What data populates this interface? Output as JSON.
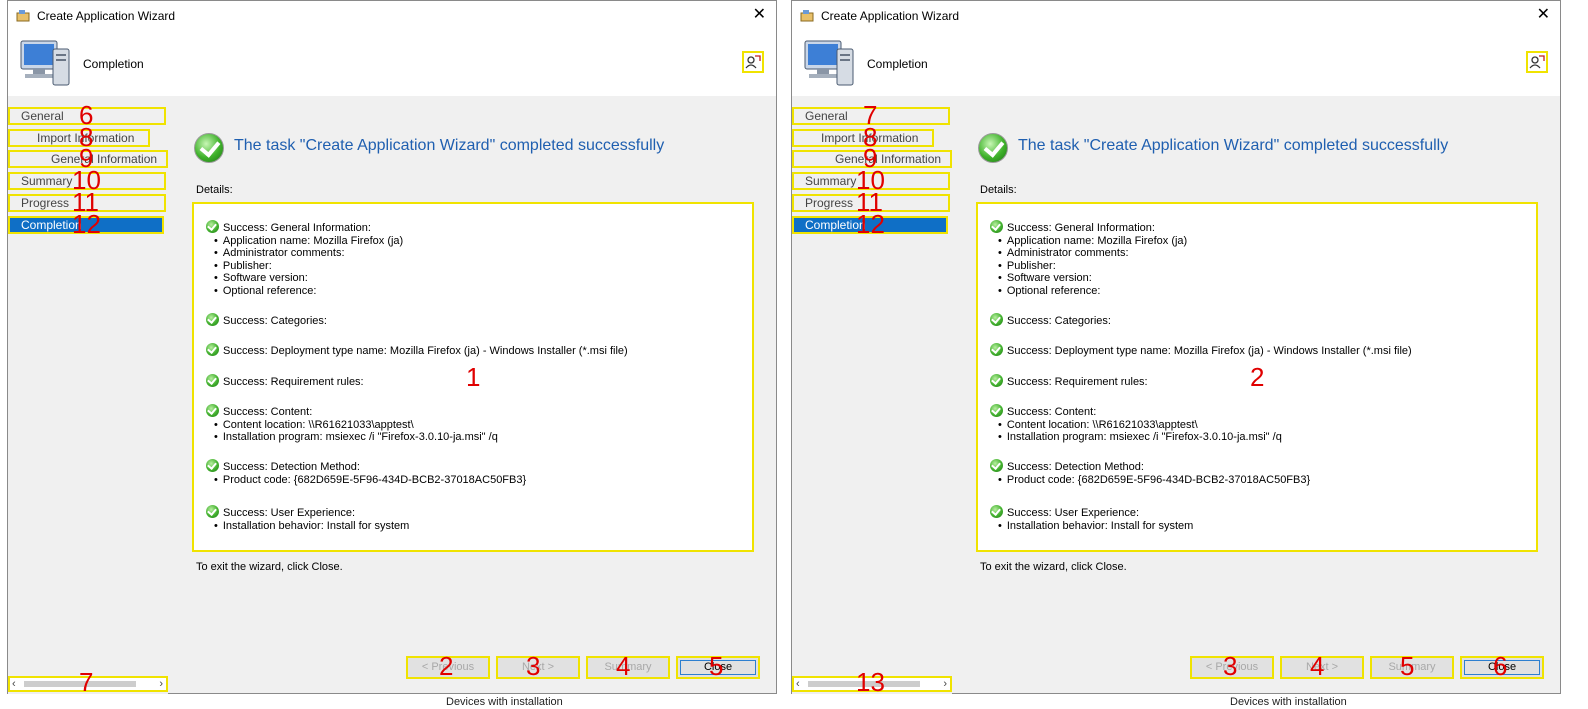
{
  "background": {
    "footer_text": "Devices with installation"
  },
  "windows": [
    {
      "title": "Create Application Wizard",
      "header_title": "Completion",
      "nav": [
        {
          "label": "General",
          "num": "6"
        },
        {
          "label": "Import Information",
          "num": "8"
        },
        {
          "label": "General Information",
          "num": "9"
        },
        {
          "label": "Summary",
          "num": "10"
        },
        {
          "label": "Progress",
          "num": "11"
        },
        {
          "label": "Completion",
          "num": "12"
        }
      ],
      "scroll_num": "7",
      "success_title": "The task \"Create Application Wizard\" completed successfully",
      "details_label": "Details:",
      "details_num": "1",
      "groups": [
        {
          "head": "Success: General Information:",
          "items": [
            "Application name: Mozilla Firefox (ja)",
            "Administrator comments:",
            "Publisher:",
            "Software version:",
            "Optional reference:"
          ]
        },
        {
          "head": "Success: Categories:",
          "items": []
        },
        {
          "head": "Success: Deployment type name: Mozilla Firefox (ja) - Windows Installer (*.msi file)",
          "items": []
        },
        {
          "head": "Success: Requirement rules:",
          "items": []
        },
        {
          "head": "Success: Content:",
          "items": [
            "Content location: \\\\R61621033\\apptest\\",
            "Installation program: msiexec /i \"Firefox-3.0.10-ja.msi\" /q"
          ]
        },
        {
          "head": "Success: Detection Method:",
          "items": [
            "Product code: {682D659E-5F96-434D-BCB2-37018AC50FB3}"
          ]
        },
        {
          "head": "Success: User Experience:",
          "items": [
            "Installation behavior: Install for system"
          ]
        }
      ],
      "exit_text": "To exit the wizard, click Close.",
      "buttons": [
        {
          "label": "< Previous",
          "num": "2",
          "enabled": false
        },
        {
          "label": "Next >",
          "num": "3",
          "enabled": false
        },
        {
          "label": "Summary",
          "num": "4",
          "enabled": false
        },
        {
          "label": "Close",
          "num": "5",
          "enabled": true
        }
      ]
    },
    {
      "title": "Create Application Wizard",
      "header_title": "Completion",
      "nav": [
        {
          "label": "General",
          "num": "7"
        },
        {
          "label": "Import Information",
          "num": "8"
        },
        {
          "label": "General Information",
          "num": "9"
        },
        {
          "label": "Summary",
          "num": "10"
        },
        {
          "label": "Progress",
          "num": "11"
        },
        {
          "label": "Completion",
          "num": "12"
        }
      ],
      "scroll_num": "13",
      "success_title": "The task \"Create Application Wizard\" completed successfully",
      "details_label": "Details:",
      "details_num": "2",
      "groups": [
        {
          "head": "Success: General Information:",
          "items": [
            "Application name: Mozilla Firefox (ja)",
            "Administrator comments:",
            "Publisher:",
            "Software version:",
            "Optional reference:"
          ]
        },
        {
          "head": "Success: Categories:",
          "items": []
        },
        {
          "head": "Success: Deployment type name: Mozilla Firefox (ja) - Windows Installer (*.msi file)",
          "items": []
        },
        {
          "head": "Success: Requirement rules:",
          "items": []
        },
        {
          "head": "Success: Content:",
          "items": [
            "Content location: \\\\R61621033\\apptest\\",
            "Installation program: msiexec /i \"Firefox-3.0.10-ja.msi\" /q"
          ]
        },
        {
          "head": "Success: Detection Method:",
          "items": [
            "Product code: {682D659E-5F96-434D-BCB2-37018AC50FB3}"
          ]
        },
        {
          "head": "Success: User Experience:",
          "items": [
            "Installation behavior: Install for system"
          ]
        }
      ],
      "exit_text": "To exit the wizard, click Close.",
      "buttons": [
        {
          "label": "< Previous",
          "num": "3",
          "enabled": false
        },
        {
          "label": "Next >",
          "num": "4",
          "enabled": false
        },
        {
          "label": "Summary",
          "num": "5",
          "enabled": false
        },
        {
          "label": "Close",
          "num": "6",
          "enabled": true
        }
      ]
    }
  ]
}
